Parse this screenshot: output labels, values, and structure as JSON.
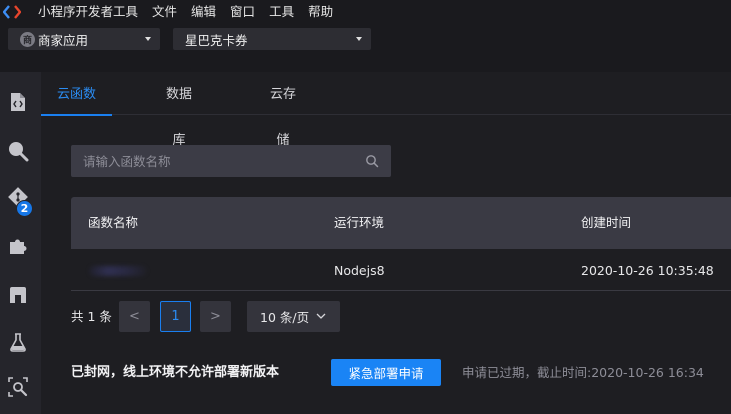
{
  "menubar": {
    "items": [
      "小程序开发者工具",
      "文件",
      "编辑",
      "窗口",
      "工具",
      "帮助"
    ]
  },
  "toolbar": {
    "app_select": {
      "avatar_text": "商",
      "value": "商家应用"
    },
    "project_select": {
      "value": "星巴克卡券"
    }
  },
  "sidebar": {
    "badge_count": "2",
    "icons": [
      "code-file-icon",
      "search-icon",
      "git-icon",
      "extensions-icon",
      "cloud-storage-icon",
      "test-flask-icon",
      "inspect-icon"
    ]
  },
  "tabs": [
    {
      "label": "云函数",
      "active": true
    },
    {
      "label": "数据库",
      "active": false
    },
    {
      "label": "云存储",
      "active": false
    }
  ],
  "search": {
    "placeholder": "请输入函数名称",
    "value": ""
  },
  "table": {
    "headers": [
      "函数名称",
      "运行环境",
      "创建时间"
    ],
    "rows": [
      {
        "name": "",
        "runtime": "Nodejs8",
        "created": "2020-10-26 10:35:48"
      }
    ]
  },
  "pager": {
    "total": "共 1 条",
    "prev": "<",
    "current_page": "1",
    "next": ">",
    "page_size": "10 条/页"
  },
  "notice": {
    "message": "已封网，线上环境不允许部署新版本",
    "button": "紧急部署申请",
    "expired": "申请已过期，截止时间:2020-10-26 16:34"
  },
  "colors": {
    "accent": "#1a84f5",
    "background": "#1e1e22",
    "sidebar": "#25252b",
    "table_header": "#3a3a44"
  }
}
